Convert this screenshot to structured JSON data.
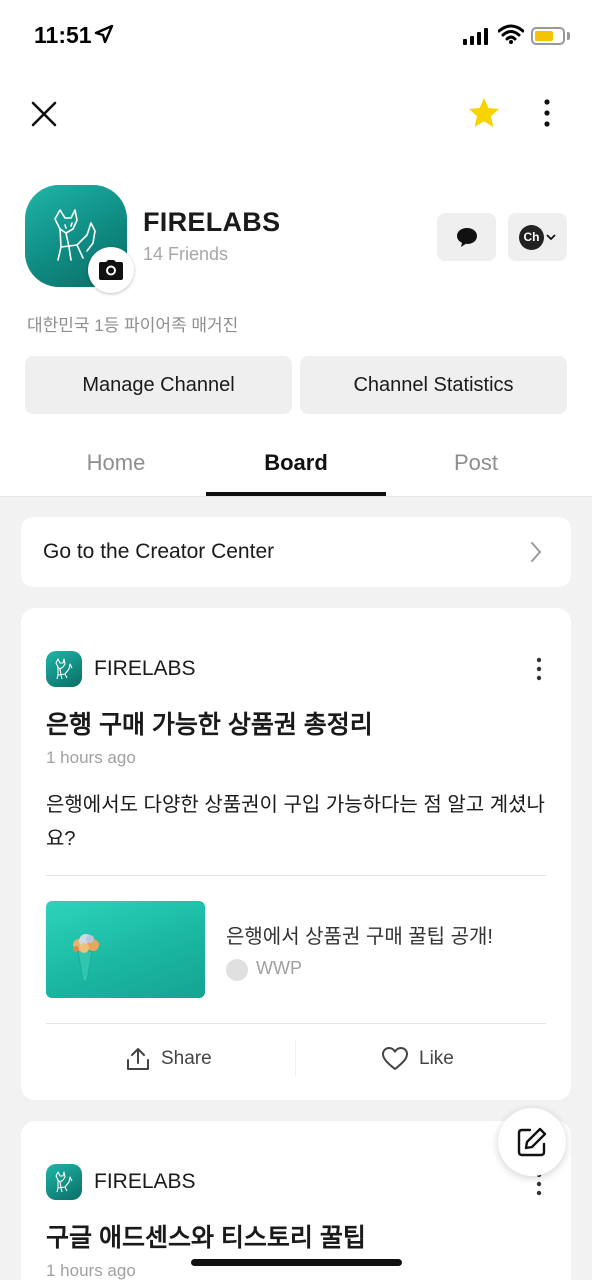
{
  "status_bar": {
    "time": "11:51",
    "battery_color": "#f5c400",
    "icons": [
      "location-arrow-icon",
      "signal-icon",
      "wifi-icon",
      "battery-icon"
    ]
  },
  "nav": {
    "icons": [
      "close-icon",
      "star-icon",
      "more-vertical-icon"
    ],
    "star_color": "#f7d300"
  },
  "profile": {
    "name": "FIRELABS",
    "friends": "14 Friends",
    "description": "대한민국 1등 파이어족 매거진",
    "ch_badge": "Ch",
    "avatar_color": "#139c92"
  },
  "actions": {
    "manage": "Manage Channel",
    "stats": "Channel Statistics"
  },
  "tabs": [
    {
      "label": "Home",
      "active": false
    },
    {
      "label": "Board",
      "active": true
    },
    {
      "label": "Post",
      "active": false
    }
  ],
  "creator_center": {
    "label": "Go to the Creator Center"
  },
  "posts": [
    {
      "author": "FIRELABS",
      "title": "은행 구매 가능한 상품권 총정리",
      "time": "1 hours ago",
      "body": "은행에서도 다양한 상품권이 구입 가능하다는 점 알고 계셨나요?",
      "link": {
        "title": "은행에서 상품권 구매 꿀팁 공개!",
        "source": "WWP"
      },
      "share_label": "Share",
      "like_label": "Like"
    },
    {
      "author": "FIRELABS",
      "title": "구글 애드센스와 티스토리 꿀팁",
      "time": "1 hours ago"
    }
  ]
}
